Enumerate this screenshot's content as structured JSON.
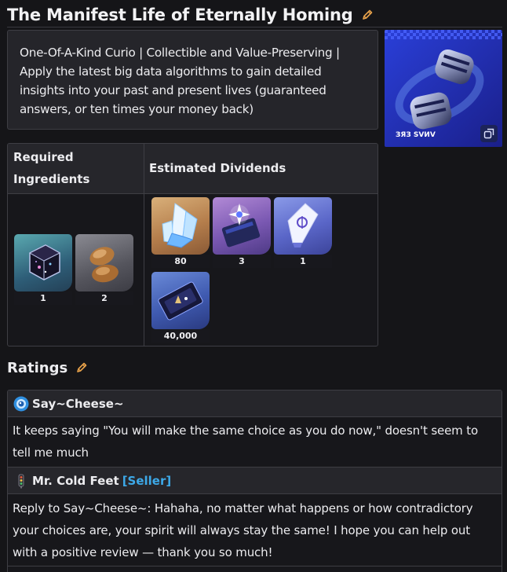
{
  "page": {
    "title": "The Manifest Life of Eternally Homing",
    "edit_icon": "pencil-icon"
  },
  "description": "One-Of-A-Kind Curio | Collectible and Value-Preserving | Apply the latest big data algorithms to gain detailed insights into your past and present lives (guaranteed answers, or ten times your money back)",
  "thumbnail": {
    "caption": "ЗЯЗ ЅVИV",
    "expand_icon": "expand-icon"
  },
  "table": {
    "col_required": "Required Ingredients",
    "col_dividends": "Estimated Dividends",
    "required": [
      {
        "icon": "cube-crystal-icon",
        "qty": "1"
      },
      {
        "icon": "beans-icon",
        "qty": "2"
      }
    ],
    "dividends": [
      {
        "icon": "crystal-cluster-icon",
        "qty": "80"
      },
      {
        "icon": "book-sparkle-icon",
        "qty": "3"
      },
      {
        "icon": "tube-icon",
        "qty": "1"
      },
      {
        "icon": "credit-card-icon",
        "qty": "40,000"
      }
    ]
  },
  "ratings": {
    "title": "Ratings",
    "edit_icon": "pencil-icon",
    "comments": [
      {
        "author": "Say~Cheese~",
        "avatar": "camera-avatar-icon",
        "tag": "",
        "text": "It keeps saying \"You will make the same choice as you do now,\" doesn't seem to tell me much"
      },
      {
        "author": "Mr. Cold Feet",
        "avatar": "traffic-light-avatar-icon",
        "tag": "[Seller]",
        "text": "Reply to Say~Cheese~: Hahaha, no matter what happens or how contradictory your choices are, your spirit will always stay the same! I hope you can help out with a positive review — thank you so much!"
      }
    ]
  },
  "colors": {
    "background": "#151518",
    "panel": "#25252a",
    "border": "#3e3e44",
    "pencil": "#e8a24a",
    "seller_tag": "#3da9e8"
  }
}
